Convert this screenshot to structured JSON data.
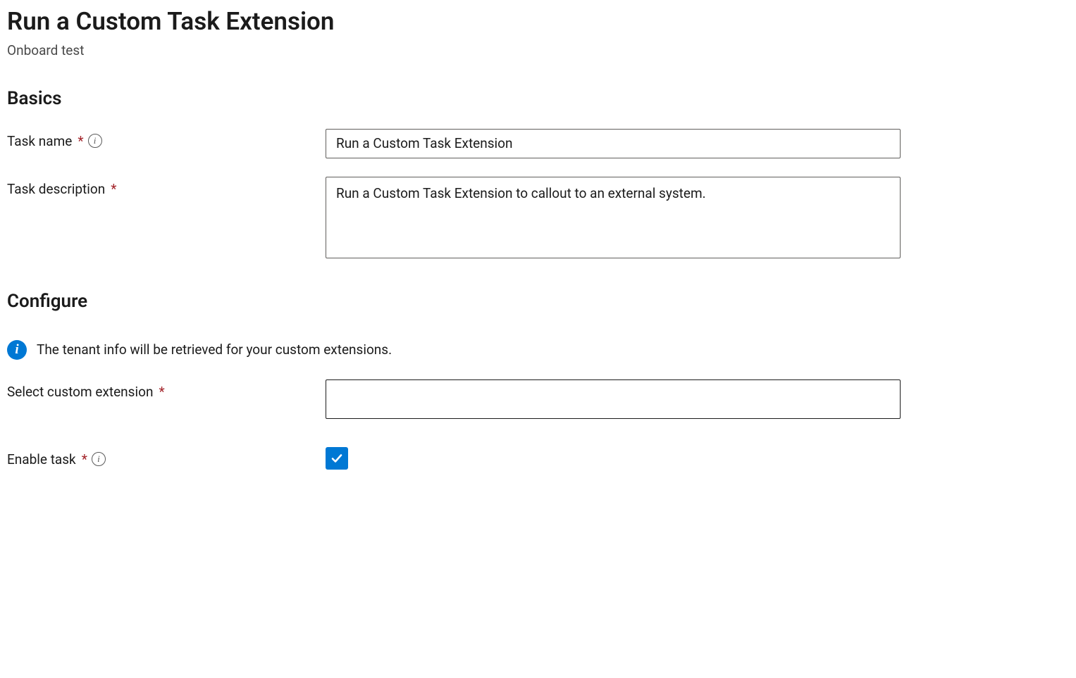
{
  "header": {
    "title": "Run a Custom Task Extension",
    "subtitle": "Onboard test"
  },
  "sections": {
    "basics": {
      "heading": "Basics",
      "fields": {
        "task_name": {
          "label": "Task name",
          "required": true,
          "value": "Run a Custom Task Extension"
        },
        "task_description": {
          "label": "Task description",
          "required": true,
          "value": "Run a Custom Task Extension to callout to an external system."
        }
      }
    },
    "configure": {
      "heading": "Configure",
      "info_text": "The tenant info will be retrieved for your custom extensions.",
      "fields": {
        "select_extension": {
          "label": "Select custom extension",
          "required": true,
          "value": ""
        },
        "enable_task": {
          "label": "Enable task",
          "required": true,
          "checked": true
        }
      }
    }
  }
}
